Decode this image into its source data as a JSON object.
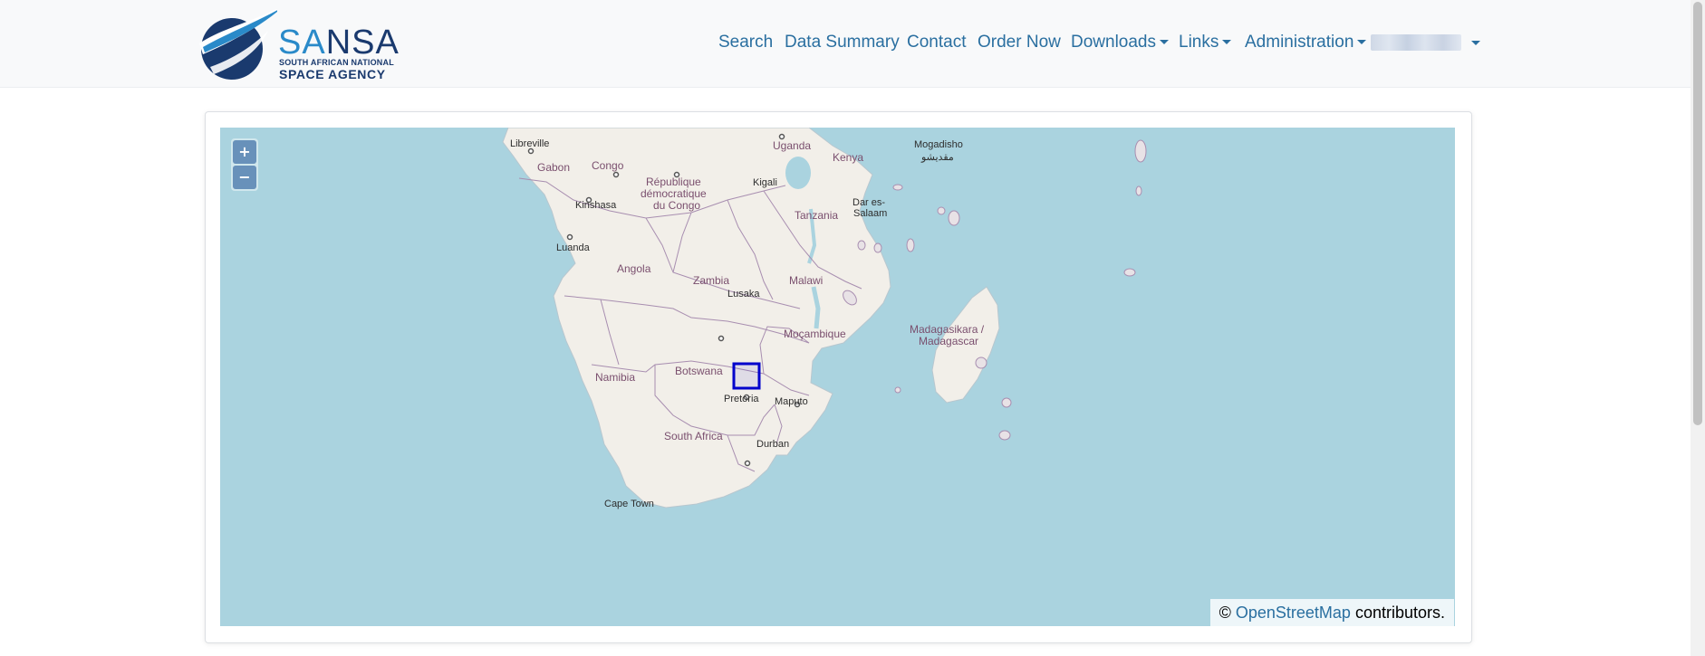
{
  "brand": {
    "name_part1": "SA",
    "name_part2": "NSA",
    "subtitle": "SOUTH AFRICAN NATIONAL",
    "subtitle2": "SPACE AGENCY"
  },
  "nav": {
    "search": "Search",
    "data_summary": "Data Summary",
    "contact": "Contact",
    "order_now": "Order Now",
    "downloads": "Downloads",
    "links": "Links",
    "administration": "Administration"
  },
  "map": {
    "zoom_in": "+",
    "zoom_out": "−",
    "attribution_prefix": "©",
    "attribution_link": "OpenStreetMap",
    "attribution_suffix": "contributors.",
    "labels": {
      "libreville": "Libreville",
      "gabon": "Gabon",
      "congo": "Congo",
      "uganda": "Uganda",
      "mogadisho": "Mogadisho",
      "mogadisho_ar": "مقديشو",
      "kenya": "Kenya",
      "kigali": "Kigali",
      "rdc1": "République",
      "rdc2": "démocratique",
      "rdc3": "du Congo",
      "kinshasa": "Kinshasa",
      "dar1": "Dar es-",
      "dar2": "Salaam",
      "tanzania": "Tanzania",
      "luanda": "Luanda",
      "angola": "Angola",
      "zambia": "Zambia",
      "malawi": "Malawi",
      "lusaka": "Lusaka",
      "mocambique": "Moçambique",
      "madagascar1": "Madagasikara /",
      "madagascar2": "Madagascar",
      "botswana": "Botswana",
      "namibia": "Namibia",
      "pretoria": "Pretoria",
      "maputo": "Maputo",
      "south_africa": "South Africa",
      "durban": "Durban",
      "cape_town": "Cape Town"
    },
    "selection_color": "#0000cc"
  },
  "colors": {
    "water": "#aad3df",
    "land": "#f2efe9",
    "border": "#a88eb0",
    "link": "#2a6fa0"
  }
}
